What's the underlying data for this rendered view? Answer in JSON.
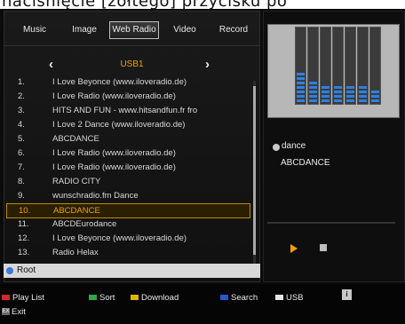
{
  "caption": "naciśnięcie [żółtego] przycisku po",
  "tabs": [
    {
      "label": "Music"
    },
    {
      "label": "Image"
    },
    {
      "label": "Web Radio"
    },
    {
      "label": "Video"
    },
    {
      "label": "Record"
    }
  ],
  "active_tab": "Web Radio",
  "folder": {
    "name": "USB1"
  },
  "list": [
    {
      "num": "1.",
      "title": "I Love Beyonce (www.iloveradio.de)"
    },
    {
      "num": "2.",
      "title": "I Love Radio (www.iloveradio.de)"
    },
    {
      "num": "3.",
      "title": "HITS AND FUN - www.hitsandfun.fr fro"
    },
    {
      "num": "4.",
      "title": "I Love 2 Dance (www.iloveradio.de)"
    },
    {
      "num": "5.",
      "title": "ABCDANCE"
    },
    {
      "num": "6.",
      "title": "I Love Radio (www.iloveradio.de)"
    },
    {
      "num": "7.",
      "title": "I Love Radio (www.iloveradio.de)"
    },
    {
      "num": "8.",
      "title": "RADIO CITY"
    },
    {
      "num": "9.",
      "title": "wunschradio.fm Dance"
    },
    {
      "num": "10.",
      "title": "ABCDANCE"
    },
    {
      "num": "11.",
      "title": "ABCDEurodance"
    },
    {
      "num": "12.",
      "title": "I Love Beyonce (www.iloveradio.de)"
    },
    {
      "num": "13.",
      "title": "Radio Helax"
    }
  ],
  "selected_index": 9,
  "path": {
    "label": "Root"
  },
  "now_playing": {
    "genre": "dance",
    "station": "ABCDANCE"
  },
  "spectrum_levels": [
    0.7,
    0.45,
    0.4,
    0.38,
    0.38,
    0.35,
    0.3
  ],
  "footer": {
    "playlist": "Play List",
    "sort": "Sort",
    "download": "Download",
    "search": "Search",
    "usb": "USB",
    "info": "i",
    "exit": "Exit"
  },
  "colors": {
    "accent": "#f2a000",
    "key_red": "#d12a2a",
    "key_green": "#2ea84a",
    "key_yellow": "#e3b400",
    "key_blue": "#2a55d1",
    "key_white": "#e6e6e6"
  }
}
